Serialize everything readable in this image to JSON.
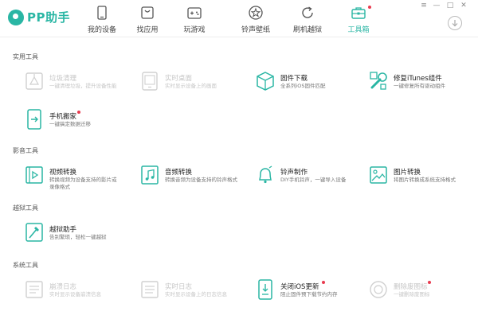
{
  "app": {
    "title": "PP助手"
  },
  "nav": {
    "items": [
      {
        "label": "我的设备",
        "icon": "phone-icon"
      },
      {
        "label": "找应用",
        "icon": "bag-icon"
      },
      {
        "label": "玩游戏",
        "icon": "gamepad-icon"
      },
      {
        "label": "铃声壁纸",
        "icon": "star-icon"
      },
      {
        "label": "刷机越狱",
        "icon": "refresh-icon"
      },
      {
        "label": "工具箱",
        "icon": "toolbox-icon",
        "active": true,
        "badge": true
      }
    ]
  },
  "window_controls": {
    "menu": "≡",
    "minimize": "—",
    "maximize": "□",
    "close": "✕"
  },
  "sections": [
    {
      "title": "实用工具",
      "tools": [
        {
          "name": "垃圾清理",
          "desc": "一键清理垃圾，提升设备性能",
          "enabled": false,
          "icon": "broom-icon"
        },
        {
          "name": "实时桌面",
          "desc": "实时显示设备上的画面",
          "enabled": false,
          "icon": "screen-icon"
        },
        {
          "name": "固件下载",
          "desc": "全系列iOS固件匹配",
          "enabled": true,
          "icon": "box-icon"
        },
        {
          "name": "修复iTunes组件",
          "desc": "一键修复所有驱动组件",
          "enabled": true,
          "icon": "wrench-icon"
        },
        {
          "name": "手机搬家",
          "desc": "一键搞定数据迁移",
          "enabled": true,
          "icon": "phone-transfer-icon",
          "badge": true
        }
      ]
    },
    {
      "title": "影音工具",
      "tools": [
        {
          "name": "视频转换",
          "desc": "转换视频为设备支持的影片或\n录像格式",
          "enabled": true,
          "icon": "film-icon"
        },
        {
          "name": "音频转换",
          "desc": "转换音频为设备支持的铃声格式",
          "enabled": true,
          "icon": "music-icon"
        },
        {
          "name": "铃声制作",
          "desc": "DIY手机铃声，一键导入设备",
          "enabled": true,
          "icon": "bell-icon"
        },
        {
          "name": "图片转换",
          "desc": "将图片转换成系统支持格式",
          "enabled": true,
          "icon": "image-icon"
        }
      ]
    },
    {
      "title": "越狱工具",
      "tools": [
        {
          "name": "越狱助手",
          "desc": "告别繁琐，轻松一键越狱",
          "enabled": true,
          "icon": "key-icon"
        }
      ]
    },
    {
      "title": "系统工具",
      "tools": [
        {
          "name": "崩溃日志",
          "desc": "实时显示设备崩溃信息",
          "enabled": false,
          "icon": "log-icon"
        },
        {
          "name": "实时日志",
          "desc": "实时显示设备上的日志信息",
          "enabled": false,
          "icon": "log-live-icon"
        },
        {
          "name": "关闭iOS更新",
          "desc": "阻止固件预下载节约内存",
          "enabled": true,
          "icon": "update-off-icon",
          "badge": true
        },
        {
          "name": "删除废图标",
          "desc": "一键删除废图标",
          "enabled": false,
          "icon": "delete-icon-icon",
          "badge": true
        }
      ]
    }
  ],
  "colors": {
    "accent": "#2ab6a4",
    "badge": "#e83b4f",
    "disabled": "#c6c6c6"
  }
}
